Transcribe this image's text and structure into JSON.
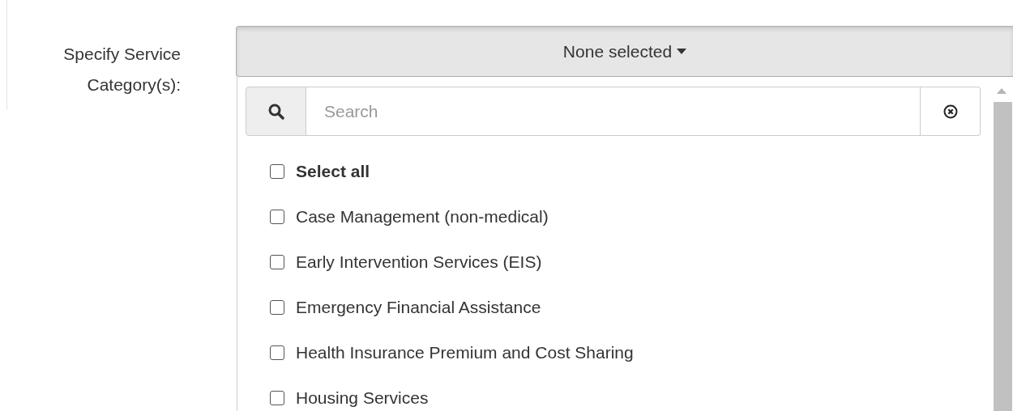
{
  "field": {
    "label": "Specify Service Category(s):"
  },
  "dropdown": {
    "button_text": "None selected",
    "expanded": true,
    "search": {
      "placeholder": "Search"
    },
    "options": [
      {
        "label": "Select all",
        "kind": "select-all",
        "checked": false
      },
      {
        "label": "Case Management (non-medical)",
        "kind": "option",
        "checked": false
      },
      {
        "label": "Early Intervention Services (EIS)",
        "kind": "option",
        "checked": false
      },
      {
        "label": "Emergency Financial Assistance",
        "kind": "option",
        "checked": false
      },
      {
        "label": "Health Insurance Premium and Cost Sharing",
        "kind": "option",
        "checked": false
      },
      {
        "label": "Housing Services",
        "kind": "option",
        "checked": false
      }
    ]
  }
}
